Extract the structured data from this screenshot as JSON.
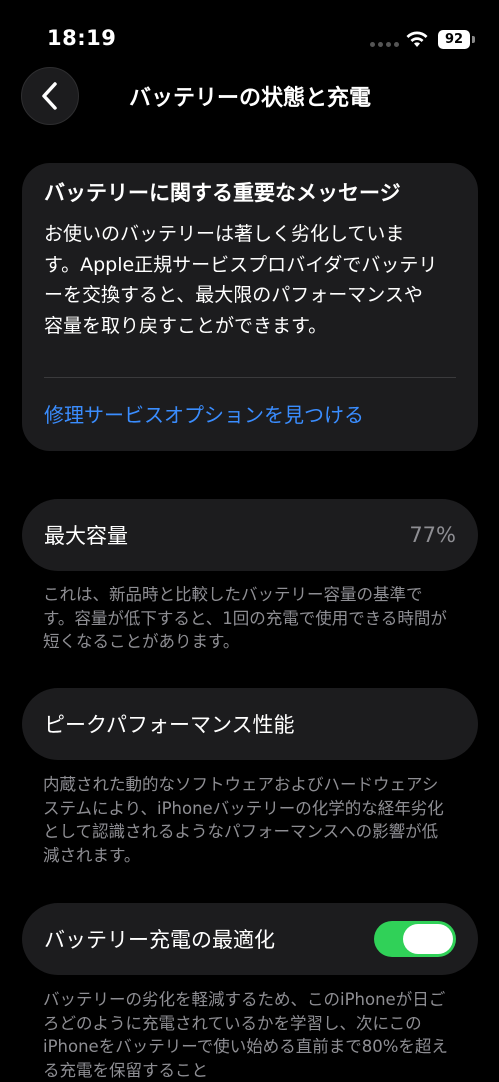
{
  "status_bar": {
    "time": "18:19",
    "battery_level": "92"
  },
  "nav": {
    "title": "バッテリーの状態と充電"
  },
  "message_card": {
    "title": "バッテリーに関する重要なメッセージ",
    "body": "お使いのバッテリーは著しく劣化しています。Apple正規サービスプロバイダでバッテリーを交換すると、最大限のパフォーマンスや容量を取り戻すことができます。",
    "link": "修理サービスオプションを見つける"
  },
  "max_capacity": {
    "label": "最大容量",
    "value": "77%",
    "footnote": "これは、新品時と比較したバッテリー容量の基準です。容量が低下すると、1回の充電で使用できる時間が短くなることがあります。"
  },
  "peak_performance": {
    "label": "ピークパフォーマンス性能",
    "footnote": "内蔵された動的なソフトウェアおよびハードウェアシステムにより、iPhoneバッテリーの化学的な経年劣化として認識されるようなパフォーマンスへの影響が低減されます。"
  },
  "optimized_charging": {
    "label": "バッテリー充電の最適化",
    "enabled": true,
    "footnote": "バッテリーの劣化を軽減するため、このiPhoneが日ごろどのように充電されているかを学習し、次にこのiPhoneをバッテリーで使い始める直前まで80%を超える充電を保留すること"
  },
  "colors": {
    "background": "#000000",
    "card": "#1c1c1e",
    "link": "#3a8dff",
    "secondary_text": "#8e8e93",
    "toggle_on": "#30d158"
  }
}
